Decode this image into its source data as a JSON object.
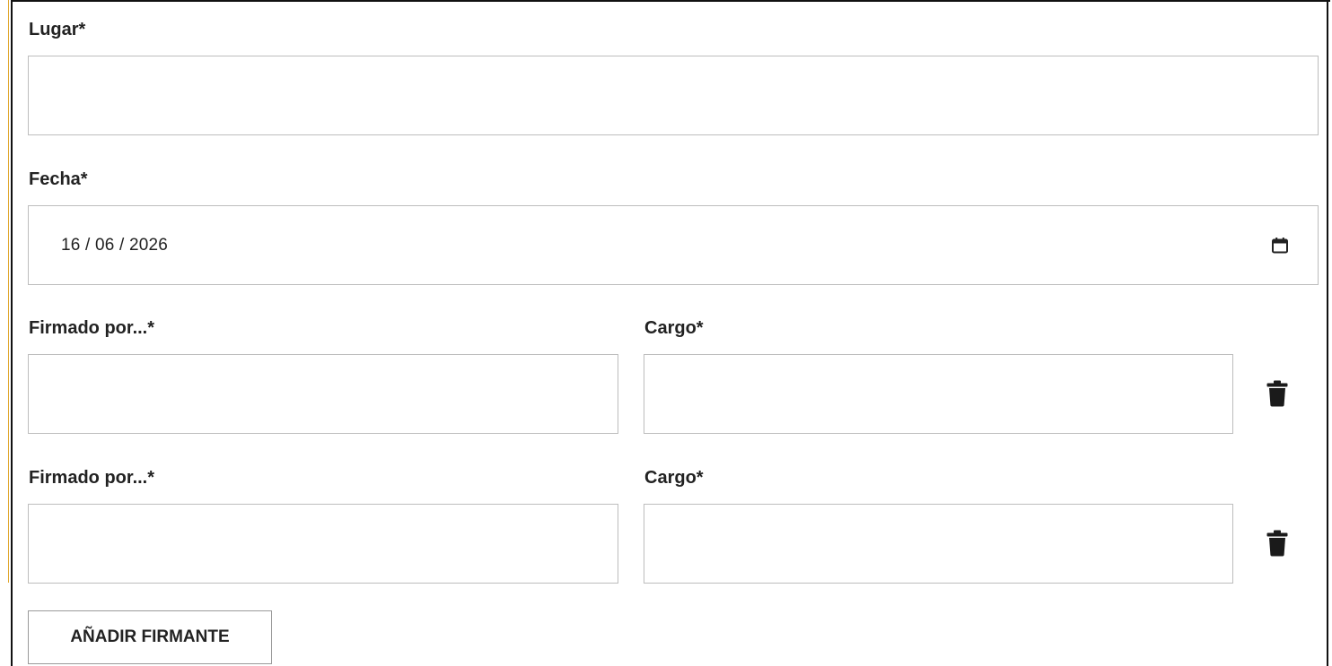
{
  "form": {
    "lugar": {
      "label": "Lugar*",
      "value": ""
    },
    "fecha": {
      "label": "Fecha*",
      "value": "16 / 06 / 2026"
    },
    "signers": [
      {
        "firmado_label": "Firmado por...*",
        "firmado_value": "",
        "cargo_label": "Cargo*",
        "cargo_value": ""
      },
      {
        "firmado_label": "Firmado por...*",
        "firmado_value": "",
        "cargo_label": "Cargo*",
        "cargo_value": ""
      }
    ],
    "add_signer_label": "AÑADIR FIRMANTE"
  },
  "icons": {
    "date_picker": "calendar-icon",
    "delete": "trash-icon"
  },
  "colors": {
    "accent_left_border": "#e0a52a",
    "field_border": "#bdbdbd",
    "text": "#222222"
  }
}
